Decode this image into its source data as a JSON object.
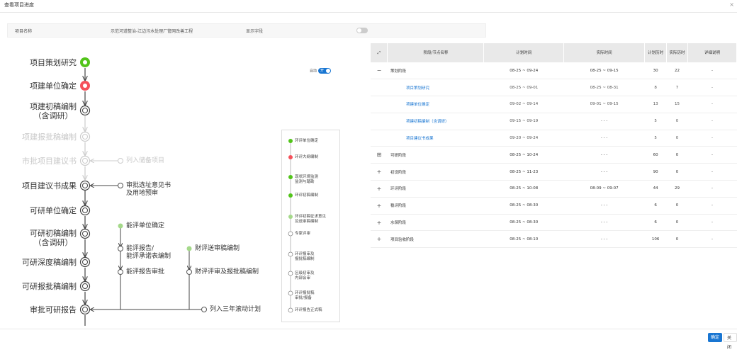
{
  "dialog": {
    "title": "查看项目进度",
    "close": "×"
  },
  "info": {
    "project_label": "项目名称",
    "project_value": "示范河道整治-江边污水处理厂管网改善工程",
    "show_label": "显示字段"
  },
  "flow": {
    "main_nodes": [
      {
        "label": "项目策划研究",
        "status": "done"
      },
      {
        "label": "项建单位确定",
        "status": "delayed"
      },
      {
        "label": "项建初稿编制\n（含调研）",
        "status": "pending"
      },
      {
        "label": "项建报批稿编制",
        "status": "disabled"
      },
      {
        "label": "市批项目建议书",
        "status": "disabled"
      },
      {
        "label": "项目建议书成果",
        "status": "pending"
      },
      {
        "label": "可研单位确定",
        "status": "pending"
      },
      {
        "label": "可研初稿编制\n（含调研）",
        "status": "pending"
      },
      {
        "label": "可研深度稿编制",
        "status": "pending"
      },
      {
        "label": "可研报批稿编制",
        "status": "pending"
      },
      {
        "label": "审批可研报告",
        "status": "pending"
      }
    ],
    "side_nodes": {
      "reserve": "列入储备项目",
      "site": "审批选址意见书\n及用地预审",
      "eval_unit": "能评单位确定",
      "eval_report": "能评报告/\n能评承诺表编制",
      "eval_approve": "能评报告审批",
      "fin_draft": "财评送审稿编制",
      "fin_review": "财评评审及报批稿编制",
      "three_year": "列入三年滚动计划"
    },
    "auto_switch": {
      "label": "自动",
      "state": "开"
    }
  },
  "mini_flow": [
    {
      "label": "环评单位确定",
      "status": "done"
    },
    {
      "label": "环评大纲编制",
      "status": "delayed"
    },
    {
      "label": "现状环境监测\n监测与踏勘",
      "status": "done"
    },
    {
      "label": "环评初稿编制",
      "status": "done"
    },
    {
      "label": "环评初稿征求意见\n及送审稿编制",
      "status": "light"
    },
    {
      "label": "专家评审",
      "status": "pending"
    },
    {
      "label": "环评报审及\n报批稿编制",
      "status": "pending"
    },
    {
      "label": "区级初审及\n内部会审",
      "status": "pending"
    },
    {
      "label": "环评报批稿\n审批/报备",
      "status": "pending"
    },
    {
      "label": "环评报告正式稿",
      "status": "pending"
    }
  ],
  "table": {
    "headers": [
      "阶段/节点名称",
      "计划时间",
      "实际时间",
      "计划历时",
      "实际历时",
      "详细说明"
    ],
    "rows": [
      {
        "expand": "−",
        "name": "策划阶段",
        "plan": "08-25 ~ 09-24",
        "actual": "08-25 ~ 09-15",
        "plan_days": "30",
        "actual_days": "22",
        "note": "-",
        "child": false
      },
      {
        "expand": "",
        "name": "项目策划研究",
        "plan": "08-25 ~ 09-01",
        "actual": "08-25 ~ 08-31",
        "plan_days": "8",
        "actual_days": "7",
        "note": "-",
        "child": true
      },
      {
        "expand": "",
        "name": "项建单位确定",
        "plan": "09-02 ~ 09-14",
        "actual": "09-01 ~ 09-15",
        "plan_days": "13",
        "actual_days": "15",
        "note": "-",
        "child": true
      },
      {
        "expand": "",
        "name": "项建初稿编制（含调研）",
        "plan": "09-15 ~ 09-19",
        "actual": "- - -",
        "plan_days": "5",
        "actual_days": "0",
        "note": "-",
        "child": true
      },
      {
        "expand": "",
        "name": "项目建议书成果",
        "plan": "09-20 ~ 09-24",
        "actual": "- - -",
        "plan_days": "5",
        "actual_days": "0",
        "note": "-",
        "child": true
      },
      {
        "expand": "⊞",
        "name": "可研阶段",
        "plan": "08-25 ~ 10-24",
        "actual": "- - -",
        "plan_days": "60",
        "actual_days": "0",
        "note": "-",
        "child": false
      },
      {
        "expand": "+",
        "name": "初设阶段",
        "plan": "08-25 ~ 11-23",
        "actual": "- - -",
        "plan_days": "90",
        "actual_days": "0",
        "note": "-",
        "child": false
      },
      {
        "expand": "+",
        "name": "环评阶段",
        "plan": "08-25 ~ 10-08",
        "actual": "08-09 ~ 09-07",
        "plan_days": "44",
        "actual_days": "29",
        "note": "-",
        "child": false
      },
      {
        "expand": "+",
        "name": "稳评阶段",
        "plan": "08-25 ~ 08-30",
        "actual": "- - -",
        "plan_days": "6",
        "actual_days": "0",
        "note": "-",
        "child": false
      },
      {
        "expand": "+",
        "name": "水保阶段",
        "plan": "08-25 ~ 08-30",
        "actual": "- - -",
        "plan_days": "6",
        "actual_days": "0",
        "note": "-",
        "child": false
      },
      {
        "expand": "+",
        "name": "项目验收阶段",
        "plan": "08-25 ~ 08-10",
        "actual": "- - -",
        "plan_days": "106",
        "actual_days": "0",
        "note": "-",
        "child": false
      }
    ]
  },
  "footer": {
    "confirm": "确定",
    "close": "关闭"
  },
  "colors": {
    "done": "#52c41a",
    "delayed": "#f5505a",
    "light": "#a5d98a",
    "primary": "#1976d2"
  }
}
